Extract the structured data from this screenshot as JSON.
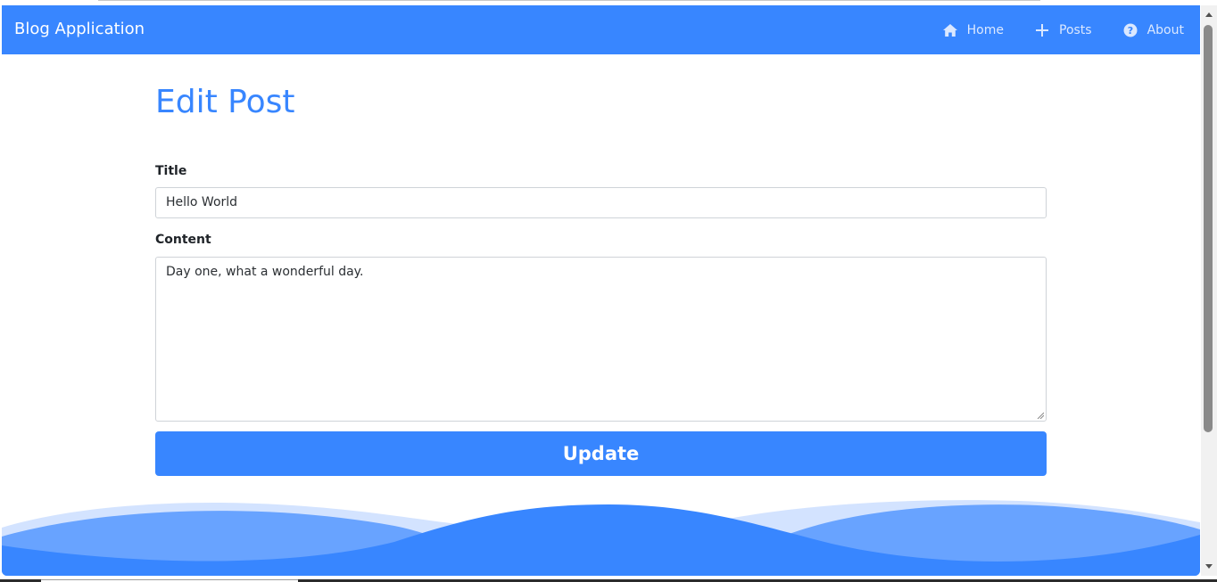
{
  "navbar": {
    "brand": "Blog Application",
    "links": [
      {
        "label": "Home",
        "icon": "home-icon"
      },
      {
        "label": "Posts",
        "icon": "plus-icon"
      },
      {
        "label": "About",
        "icon": "question-circle-icon"
      }
    ]
  },
  "page": {
    "heading": "Edit Post"
  },
  "form": {
    "title_label": "Title",
    "title_value": "Hello World",
    "content_label": "Content",
    "content_value": "Day one, what a wonderful day.",
    "submit_label": "Update"
  },
  "colors": {
    "primary": "#3886ff",
    "wave_light": "#d3e3ff",
    "wave_mid": "#68a3ff"
  }
}
